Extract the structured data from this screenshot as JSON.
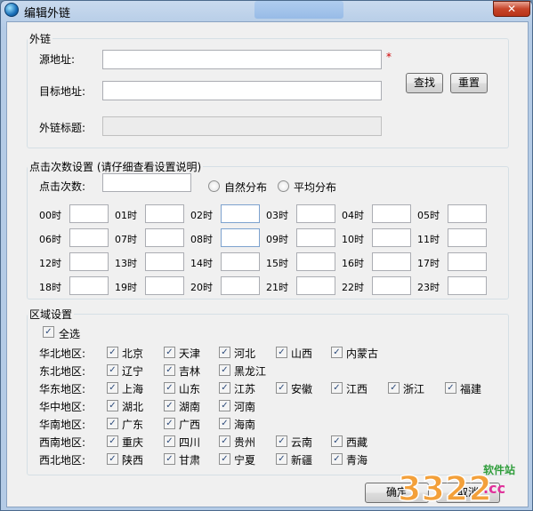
{
  "window": {
    "title": "编辑外链",
    "close_label": "✕"
  },
  "link_group": {
    "legend": "外链",
    "source_label": "源地址:",
    "source_value": "",
    "required_mark": "*",
    "target_label": "目标地址:",
    "target_value": "",
    "title_label": "外链标题:",
    "title_value": "",
    "find_button": "查找",
    "reset_button": "重置"
  },
  "click_group": {
    "legend": "点击次数设置 (请仔细查看设置说明)",
    "count_label": "点击次数:",
    "count_value": "",
    "radio_natural": "自然分布",
    "radio_average": "平均分布",
    "hours": [
      "00时",
      "01时",
      "02时",
      "03时",
      "04时",
      "05时",
      "06时",
      "07时",
      "08时",
      "09时",
      "10时",
      "11时",
      "12时",
      "13时",
      "14时",
      "15时",
      "16时",
      "17时",
      "18时",
      "19时",
      "20时",
      "21时",
      "22时",
      "23时"
    ]
  },
  "region_group": {
    "legend": "区域设置",
    "select_all": "全选",
    "regions": [
      {
        "name": "华北地区:",
        "provinces": [
          "北京",
          "天津",
          "河北",
          "山西",
          "内蒙古"
        ]
      },
      {
        "name": "东北地区:",
        "provinces": [
          "辽宁",
          "吉林",
          "黑龙江"
        ]
      },
      {
        "name": "华东地区:",
        "provinces": [
          "上海",
          "山东",
          "江苏",
          "安徽",
          "江西",
          "浙江",
          "福建"
        ]
      },
      {
        "name": "华中地区:",
        "provinces": [
          "湖北",
          "湖南",
          "河南"
        ]
      },
      {
        "name": "华南地区:",
        "provinces": [
          "广东",
          "广西",
          "海南"
        ]
      },
      {
        "name": "西南地区:",
        "provinces": [
          "重庆",
          "四川",
          "贵州",
          "云南",
          "西藏"
        ]
      },
      {
        "name": "西北地区:",
        "provinces": [
          "陕西",
          "甘肃",
          "宁夏",
          "新疆",
          "青海"
        ]
      }
    ]
  },
  "footer": {
    "ok_button": "确定",
    "cancel_button": "取消"
  },
  "watermark": {
    "brand": "3322",
    "tagline": "软件站",
    "domain": ".cc"
  }
}
